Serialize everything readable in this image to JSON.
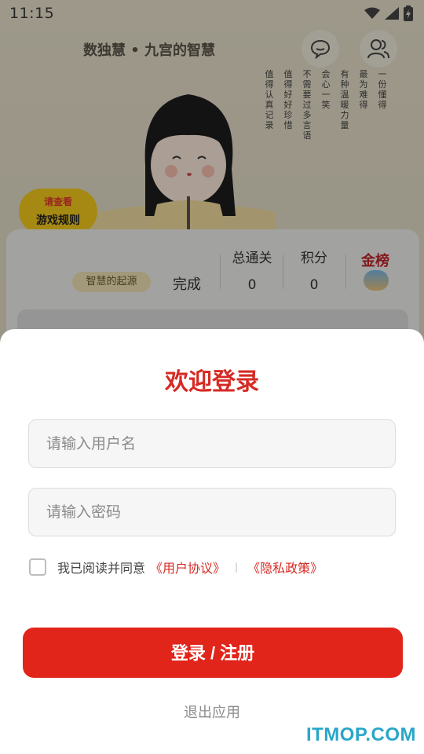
{
  "status_bar": {
    "time": "11:15"
  },
  "app": {
    "title": "数独慧 • 九宫的智慧",
    "poem_columns": [
      "一份懂得",
      "最为难得",
      "有种温暖力量",
      "会心一笑",
      "不需要过多言语",
      "值得好好珍惜",
      "值得认真记录"
    ],
    "rules_badge": {
      "top_text": "请查看",
      "label": "游戏规则"
    },
    "stats": {
      "origin_label": "智慧的起源",
      "done_label": "完成",
      "total_levels_label": "总通关",
      "total_levels_value": "0",
      "points_label": "积分",
      "points_value": "0",
      "gold_label": "金榜"
    }
  },
  "login": {
    "title": "欢迎登录",
    "username_placeholder": "请输入用户名",
    "password_placeholder": "请输入密码",
    "agree_text": "我已阅读并同意",
    "user_agreement": "《用户协议》",
    "separator": "|",
    "privacy_policy": "《隐私政策》",
    "login_button": "登录 / 注册",
    "exit_label": "退出应用"
  },
  "watermark": "ITMOP.COM",
  "colors": {
    "accent": "#e1251b",
    "title_red": "#d62a24",
    "badge_yellow": "#f3cb1d"
  }
}
